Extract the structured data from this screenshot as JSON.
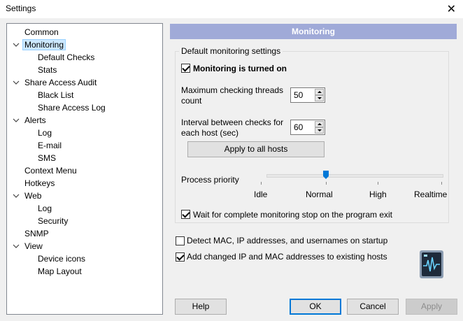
{
  "window": {
    "title": "Settings",
    "close": "✕"
  },
  "tree": {
    "items": [
      {
        "label": "Common"
      },
      {
        "label": "Monitoring"
      },
      {
        "label": "Default Checks"
      },
      {
        "label": "Stats"
      },
      {
        "label": "Share Access Audit"
      },
      {
        "label": "Black List"
      },
      {
        "label": "Share Access Log"
      },
      {
        "label": "Alerts"
      },
      {
        "label": "Log"
      },
      {
        "label": "E-mail"
      },
      {
        "label": "SMS"
      },
      {
        "label": "Context Menu"
      },
      {
        "label": "Hotkeys"
      },
      {
        "label": "Web"
      },
      {
        "label": "Log"
      },
      {
        "label": "Security"
      },
      {
        "label": "SNMP"
      },
      {
        "label": "View"
      },
      {
        "label": "Device icons"
      },
      {
        "label": "Map Layout"
      }
    ],
    "selected": "Monitoring"
  },
  "panel": {
    "header": "Monitoring",
    "group_label": "Default monitoring settings",
    "monitoring_on": {
      "label": "Monitoring is turned on",
      "checked": true
    },
    "max_threads": {
      "label_line1": "Maximum checking threads",
      "label_line2": "count",
      "value": "50"
    },
    "interval": {
      "label_line1": "Interval between checks for",
      "label_line2": "each host (sec)",
      "value": "60"
    },
    "apply_all": "Apply to all hosts",
    "priority": {
      "label": "Process priority",
      "levels": [
        "Idle",
        "Normal",
        "High",
        "Realtime"
      ],
      "selected": "Normal"
    },
    "wait_stop": {
      "label": "Wait for complete monitoring stop on the program exit",
      "checked": true
    },
    "detect_mac": {
      "label": "Detect MAC, IP addresses, and usernames on startup",
      "checked": false
    },
    "add_changed": {
      "label": "Add changed IP and MAC addresses to existing hosts",
      "checked": true
    }
  },
  "buttons": {
    "help": "Help",
    "ok": "OK",
    "cancel": "Cancel",
    "apply": "Apply"
  },
  "colors": {
    "header_bg": "#a0aad8",
    "selection": "#cce8ff",
    "accent": "#0078d7"
  }
}
